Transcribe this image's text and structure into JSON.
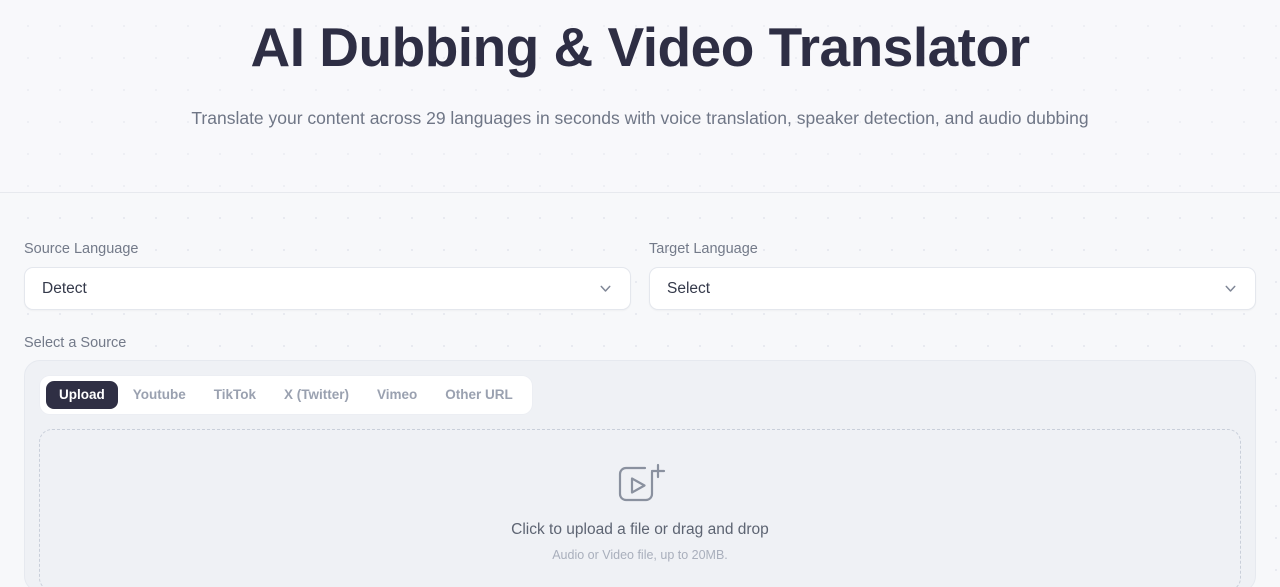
{
  "hero": {
    "title": "AI Dubbing & Video Translator",
    "subtitle": "Translate your content across 29 languages in seconds with voice translation, speaker detection, and audio dubbing"
  },
  "form": {
    "source_language": {
      "label": "Source Language",
      "value": "Detect",
      "chevron_icon": "chevron-down-icon"
    },
    "target_language": {
      "label": "Target Language",
      "value": "Select",
      "chevron_icon": "chevron-down-icon"
    },
    "source_section_label": "Select a Source",
    "tabs": [
      {
        "label": "Upload",
        "active": true
      },
      {
        "label": "Youtube",
        "active": false
      },
      {
        "label": "TikTok",
        "active": false
      },
      {
        "label": "X (Twitter)",
        "active": false
      },
      {
        "label": "Vimeo",
        "active": false
      },
      {
        "label": "Other URL",
        "active": false
      }
    ],
    "dropzone": {
      "icon": "video-plus-upload-icon",
      "primary_text": "Click to upload a file or drag and drop",
      "secondary_text": "Audio or Video file, up to 20MB."
    }
  },
  "colors": {
    "page_background": "#f7f8fa",
    "title": "#2e2e44",
    "muted_text": "#737a89",
    "active_tab_bg": "#2f2f44",
    "card_bg": "#eff1f5",
    "border": "#e4e7ed"
  }
}
